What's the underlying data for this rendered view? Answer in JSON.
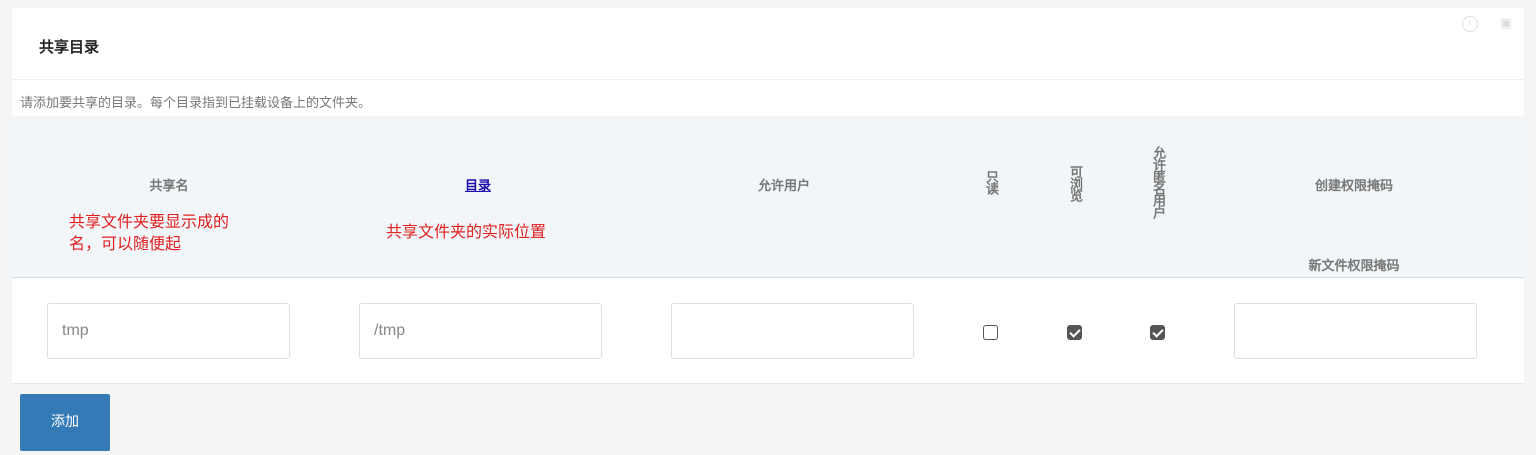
{
  "header": {
    "title": "共享目录",
    "info_icon": "info-icon",
    "collapse_icon": "collapse-icon"
  },
  "description": "请添加要共享的目录。每个目录指到已挂载设备上的文件夹。",
  "table": {
    "columns": {
      "share_name": "共享名",
      "directory": "目录",
      "allowed_users": "允许用户",
      "read_only": "只读",
      "browseable": "可浏览",
      "allow_guest": "允许匿名用户",
      "create_mask": "创建权限掩码",
      "dir_mask": "新文件权限掩码"
    },
    "annotations": {
      "share_name_note": [
        "共享文件夹要显示成的",
        "名，可以随便起"
      ],
      "directory_note": "共享文件夹的实际位置"
    },
    "row": {
      "share_name_placeholder": "tmp",
      "directory_placeholder": "/tmp",
      "allowed_users_value": "",
      "read_only": false,
      "browseable": true,
      "allow_guest": true,
      "create_mask_value": ""
    }
  },
  "footer": {
    "add_label": "添加"
  },
  "colors": {
    "accent": "#337ab7",
    "annotation": "#e02020",
    "link": "#1a0dab"
  }
}
